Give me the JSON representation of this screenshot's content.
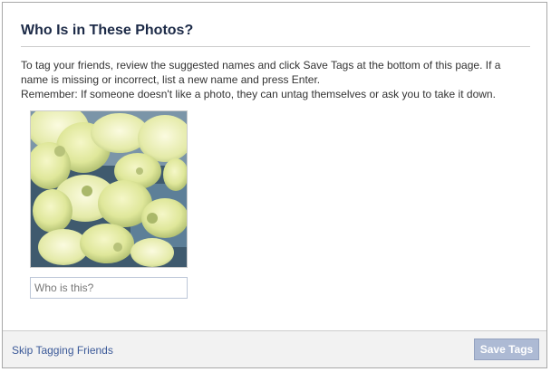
{
  "dialog": {
    "title": "Who Is in These Photos?",
    "intro_line1": "To tag your friends, review the suggested names and click Save Tags at the bottom of this page. If a name is missing or incorrect, list a new name and press Enter.",
    "intro_line2": "Remember: If someone doesn't like a photo, they can untag themselves or ask you to take it down."
  },
  "photo": {
    "name_input": {
      "value": "",
      "placeholder": "Who is this?"
    }
  },
  "footer": {
    "skip_label": "Skip Tagging Friends",
    "save_label": "Save Tags",
    "save_enabled": false
  },
  "colors": {
    "title": "#1c2a47",
    "link": "#3b5998",
    "button_disabled": "#adbad4",
    "footer_bg": "#f2f2f2"
  }
}
